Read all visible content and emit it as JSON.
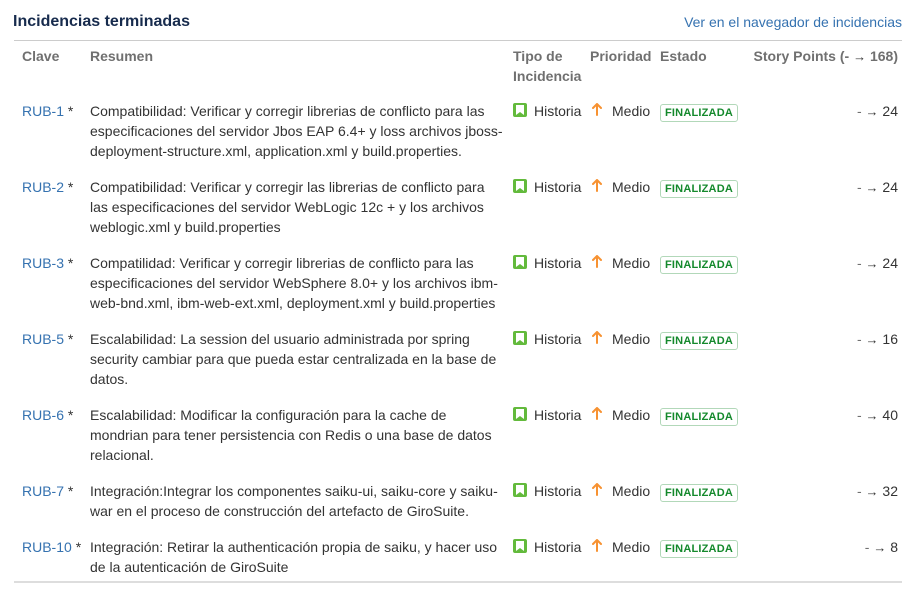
{
  "header": {
    "title": "Incidencias terminadas",
    "link": "Ver en el navegador de incidencias"
  },
  "columns": {
    "key": "Clave",
    "summary": "Resumen",
    "type": "Tipo de Incidencia",
    "priority": "Prioridad",
    "status": "Estado",
    "story_points": "Story Points (",
    "sp_from": "-",
    "sp_arrow": "→",
    "sp_to": "168",
    "sp_close": ")"
  },
  "rows": [
    {
      "key": "RUB-1",
      "star": "*",
      "summary": "Compatibilidad: Verificar y corregir librerias de conflicto para las especificaciones del servidor Jbos EAP 6.4+ y loss archivos jboss-deployment-structure.xml, application.xml y build.properties.",
      "type": "Historia",
      "priority": "Medio",
      "status": "FINALIZADA",
      "sp_from": "-",
      "sp_arrow": "→",
      "sp_to": "24"
    },
    {
      "key": "RUB-2",
      "star": "*",
      "summary": "Compatibilidad: Verificar y corregir las librerias de conflicto para las especificaciones del servidor WebLogic 12c + y los archivos weblogic.xml y build.properties",
      "type": "Historia",
      "priority": "Medio",
      "status": "FINALIZADA",
      "sp_from": "-",
      "sp_arrow": "→",
      "sp_to": "24"
    },
    {
      "key": "RUB-3",
      "star": "*",
      "summary": "Compatilidad: Verificar y corregir librerias de conflicto para las especificaciones del servidor WebSphere 8.0+ y los archivos ibm-web-bnd.xml, ibm-web-ext.xml, deployment.xml y build.properties",
      "type": "Historia",
      "priority": "Medio",
      "status": "FINALIZADA",
      "sp_from": "-",
      "sp_arrow": "→",
      "sp_to": "24"
    },
    {
      "key": "RUB-5",
      "star": "*",
      "summary": "Escalabilidad: La session del usuario administrada por spring security cambiar para que pueda estar centralizada en la base de datos.",
      "type": "Historia",
      "priority": "Medio",
      "status": "FINALIZADA",
      "sp_from": "-",
      "sp_arrow": "→",
      "sp_to": "16"
    },
    {
      "key": "RUB-6",
      "star": "*",
      "summary": "Escalabilidad: Modificar la configuración para la cache de mondrian para tener persistencia con Redis o una base de datos relacional.",
      "type": "Historia",
      "priority": "Medio",
      "status": "FINALIZADA",
      "sp_from": "-",
      "sp_arrow": "→",
      "sp_to": "40"
    },
    {
      "key": "RUB-7",
      "star": "*",
      "summary": "Integración:Integrar los componentes saiku-ui, saiku-core y saiku-war en el proceso de construcción del artefacto de GiroSuite.",
      "type": "Historia",
      "priority": "Medio",
      "status": "FINALIZADA",
      "sp_from": "-",
      "sp_arrow": "→",
      "sp_to": "32"
    },
    {
      "key": "RUB-10",
      "star": "*",
      "summary": "Integración: Retirar la authenticación propia de saiku, y hacer uso de la autenticación de GiroSuite",
      "type": "Historia",
      "priority": "Medio",
      "status": "FINALIZADA",
      "sp_from": "-",
      "sp_arrow": "→",
      "sp_to": "8"
    }
  ],
  "colors": {
    "link": "#3572b0",
    "story_icon": "#63ba3c",
    "priority_icon": "#f79232",
    "status_done": "#14892c"
  },
  "icons": {
    "type": "story-bookmark-icon",
    "priority": "priority-medium-arrow-up-icon"
  }
}
